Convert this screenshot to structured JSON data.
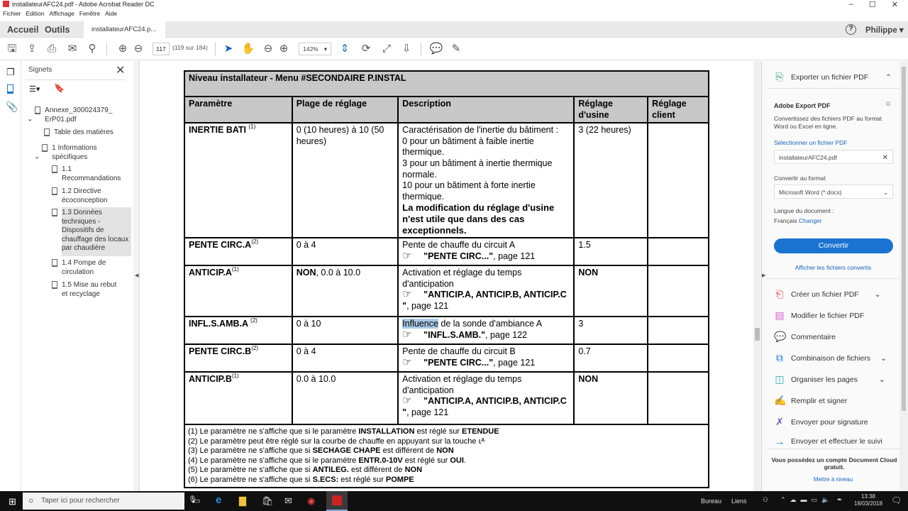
{
  "window": {
    "title": "installateurAFC24.pdf - Adobe Acrobat Reader DC",
    "minimize": "–",
    "maximize": "☐",
    "close": "✕"
  },
  "menu": [
    "Fichier",
    "Edition",
    "Affichage",
    "Fenêtre",
    "Aide"
  ],
  "tabs": {
    "home": "Accueil",
    "tools": "Outils",
    "doc": "installateurAFC24.p...",
    "close": "×",
    "help": "?",
    "user": "Philippe"
  },
  "toolbar": {
    "page": "117",
    "page_count": "(119 sur 184)",
    "zoom": "142%"
  },
  "bookmarks": {
    "title": "Signets",
    "items": [
      "Annexe_300024379_ErP01.pdf",
      "Table des matières",
      "1 Informations spécifiques",
      "1.1 Recommandations",
      "1.2 Directive écoconception",
      "1.3 Données techniques - Dispositifs de chauffage des locaux par chaudière",
      "1.4 Pompe de circulation",
      "1.5 Mise au rebut et recyclage"
    ]
  },
  "table": {
    "title": "Niveau installateur - Menu #SECONDAIRE P.INSTAL",
    "headers": [
      "Paramètre",
      "Plage de réglage",
      "Description",
      "Réglage d'usine",
      "Réglage client"
    ],
    "r1": {
      "param": "INERTIE BATI ",
      "sup": "(1)",
      "range": "0 (10 heures) à 10 (50 heures)",
      "d1": "Caractérisation de l'inertie du bâtiment :",
      "d2": "0 pour un bâtiment à faible inertie thermique.",
      "d3": "3 pour un bâtiment à inertie thermique normale.",
      "d4": "10 pour un bâtiment à forte inertie thermique.",
      "d5": "La modification du réglage d'usine n'est utile que dans des cas exceptionnels.",
      "factory": "3 (22 heures)"
    },
    "r2": {
      "param": "PENTE CIRC.A",
      "sup": "(2)",
      "range": "0 à 4",
      "desc": "Pente de chauffe du circuit A",
      "ref": "\"PENTE CIRC...\"",
      "page": ", page 121",
      "factory": "1.5"
    },
    "r3": {
      "param": "ANTICIP.A",
      "sup": "(1)",
      "range_b": "NON",
      "range": ", 0.0 à 10.0",
      "desc": "Activation et réglage du temps d'anticipation",
      "ref": "\"ANTICIP.A, ANTICIP.B, ANTICIP.C  \"",
      "page": ", page 121",
      "factory": "NON"
    },
    "r4": {
      "param": "INFL.S.AMB.A ",
      "sup": "(2)",
      "range": "0 à 10",
      "desc_hl": "Influence",
      "desc": " de la sonde d'ambiance A",
      "ref": "\"INFL.S.AMB.\"",
      "page": ", page 122",
      "factory": "3"
    },
    "r5": {
      "param": "PENTE CIRC.B",
      "sup": "(2)",
      "range": "0 à 4",
      "desc": "Pente de chauffe du circuit B",
      "ref": "\"PENTE CIRC...\"",
      "page": ", page 121",
      "factory": "0.7"
    },
    "r6": {
      "param": "ANTICIP.B",
      "sup": "(1)",
      "range": "0.0 à 10.0",
      "desc": "Activation et réglage du temps d'anticipation",
      "ref": "\"ANTICIP.A, ANTICIP.B, ANTICIP.C  \"",
      "page": ", page 121",
      "factory": "NON"
    },
    "notes": [
      [
        "(1)  Le paramètre ne s'affiche que si le paramètre ",
        "INSTALLATION",
        " est réglé sur ",
        "ETENDUE"
      ],
      [
        "(2)  Le paramètre peut être réglé sur la courbe de chauffe en appuyant sur la touche ⍳ᴬ"
      ],
      [
        "(3)  Le paramètre ne s'affiche que si ",
        "SECHAGE CHAPE",
        " est différent de ",
        "NON"
      ],
      [
        "(4)  Le paramètre ne s'affiche que si le paramètre ",
        "ENTR.0-10V",
        " est réglé sur ",
        "OUI",
        "."
      ],
      [
        "(5)  Le paramètre ne s'affiche que si ",
        "ANTILEG.",
        " est différent de ",
        "NON"
      ],
      [
        "(6)  Le paramètre ne s'affiche que si ",
        "S.ECS:",
        " est réglé sur ",
        "POMPE"
      ]
    ]
  },
  "right": {
    "export": "Exporter un fichier PDF",
    "aep": "Adobe Export PDF",
    "aep_desc": "Convertissez des fichiers PDF au format Word ou Excel en ligne.",
    "select": "Sélectionner un fichier PDF",
    "file": "installateurAFC24.pdf",
    "convert_to": "Convertir au format",
    "format": "Microsoft Word (*.docx)",
    "lang_label": "Langue du document :",
    "lang": "Français",
    "change": "Changer",
    "convert": "Convertir",
    "show": "Afficher les fichiers convertis",
    "tools": [
      "Créer un fichier PDF",
      "Modifier le fichier PDF",
      "Commentaire",
      "Combinaison de fichiers",
      "Organiser les pages",
      "Remplir et signer",
      "Envoyer pour signature",
      "Envoyer et effectuer le suivi"
    ],
    "cloud": "Vous possédez un compte Document Cloud gratuit.",
    "upgrade": "Mettre à niveau"
  },
  "taskbar": {
    "search": "Taper ici pour rechercher",
    "bureau": "Bureau",
    "liens": "Liens",
    "time": "13:38",
    "date": "18/03/2018"
  }
}
